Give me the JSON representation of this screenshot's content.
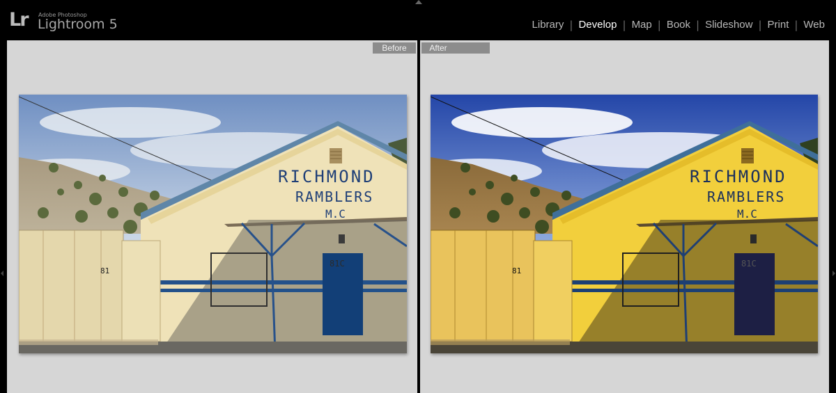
{
  "app": {
    "logo_mark": "Lr",
    "vendor": "Adobe Photoshop",
    "product": "Lightroom 5"
  },
  "modules": [
    {
      "label": "Library",
      "active": false
    },
    {
      "label": "Develop",
      "active": true
    },
    {
      "label": "Map",
      "active": false
    },
    {
      "label": "Book",
      "active": false
    },
    {
      "label": "Slideshow",
      "active": false
    },
    {
      "label": "Print",
      "active": false
    },
    {
      "label": "Web",
      "active": false
    }
  ],
  "compare": {
    "before_label": "Before",
    "after_label": "After"
  },
  "photo": {
    "sign_line1": "RICHMOND",
    "sign_line2": "RAMBLERS",
    "sign_line3": "M.C",
    "door_number": "81C",
    "container_marking": "81"
  },
  "colors": {
    "background": "#000000",
    "pane_background": "#d6d6d6",
    "label_background": "#8c8c8c",
    "active_module": "#ffffff",
    "inactive_module": "#b9b9b9"
  }
}
